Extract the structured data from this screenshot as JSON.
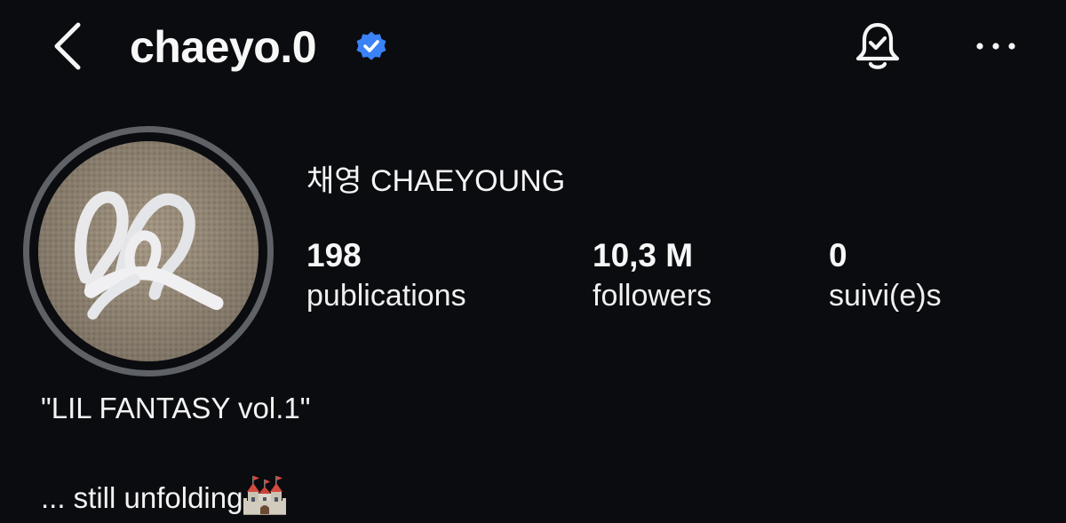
{
  "header": {
    "username": "chaeyo.0",
    "back_icon": "chevron-left-icon",
    "verified_icon": "verified-badge-icon",
    "notifications_icon": "bell-check-icon",
    "more_icon": "more-horizontal-icon"
  },
  "profile": {
    "display_name": "채영 CHAEYOUNG",
    "avatar_icon": "profile-photo"
  },
  "stats": {
    "publications": {
      "value": "198",
      "label": "publications"
    },
    "followers": {
      "value": "10,3 M",
      "label": "followers"
    },
    "following": {
      "value": "0",
      "label": "suivi(e)s"
    }
  },
  "bio": {
    "line1": "\"LIL FANTASY vol.1\"",
    "line3": "... still unfolding",
    "emoji_icon": "castle-icon"
  },
  "colors": {
    "background": "#0b0c10",
    "text": "#f5f5f5",
    "verified": "#3b82f6",
    "avatar_ring": "#5e6166"
  }
}
